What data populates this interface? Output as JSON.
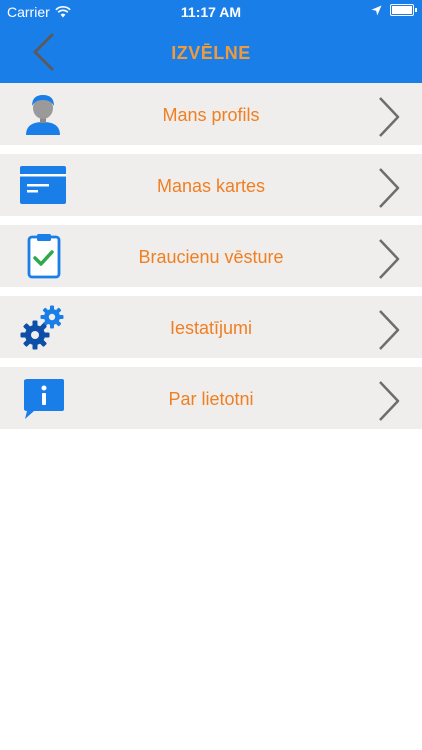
{
  "status": {
    "carrier": "Carrier",
    "time": "11:17 AM"
  },
  "header": {
    "title": "IZVĒLNE"
  },
  "colors": {
    "header_bg": "#1a7ee8",
    "title": "#f09a3e",
    "item_label": "#f07f22",
    "item_bg": "#efeeec",
    "icon_blue": "#1a7ee8"
  },
  "menu": {
    "items": [
      {
        "label": "Mans profils",
        "icon": "user-icon"
      },
      {
        "label": "Manas kartes",
        "icon": "card-icon"
      },
      {
        "label": "Braucienu vēsture",
        "icon": "clipboard-check-icon"
      },
      {
        "label": "Iestatījumi",
        "icon": "gears-icon"
      },
      {
        "label": "Par lietotni",
        "icon": "info-icon"
      }
    ]
  }
}
